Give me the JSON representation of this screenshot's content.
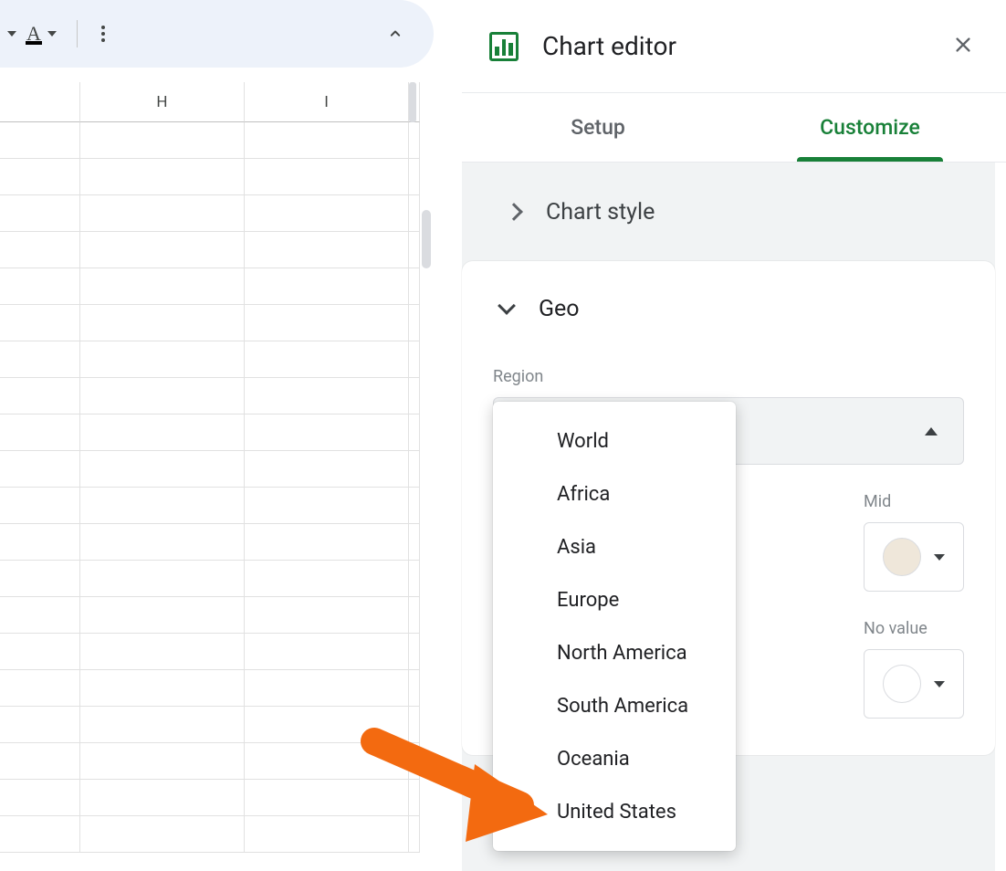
{
  "toolbar": {
    "text_color_letter": "A"
  },
  "sheet": {
    "columns": [
      "H",
      "I"
    ]
  },
  "panel": {
    "title": "Chart editor",
    "tabs": {
      "setup": "Setup",
      "customize": "Customize"
    },
    "sections": {
      "chart_style": "Chart style",
      "geo": {
        "title": "Geo",
        "region_label": "Region",
        "region_options": [
          "World",
          "Africa",
          "Asia",
          "Europe",
          "North America",
          "South America",
          "Oceania",
          "United States"
        ],
        "colors": {
          "mid_label": "Mid",
          "novalue_label": "No value"
        }
      }
    }
  }
}
